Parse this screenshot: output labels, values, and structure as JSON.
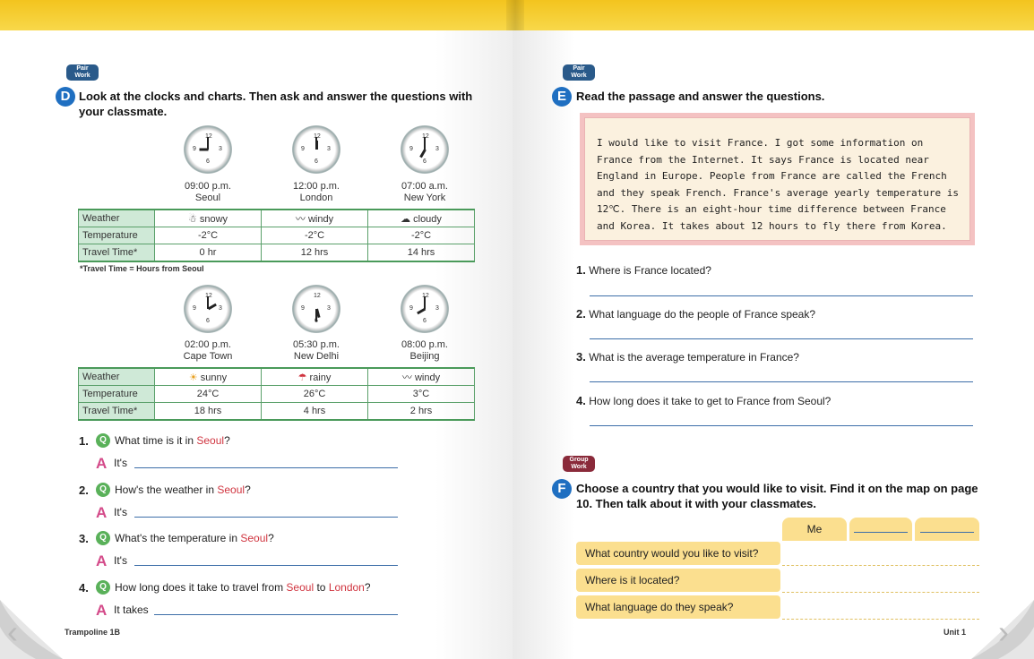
{
  "left": {
    "badge": "Pair\nWork",
    "section_letter": "D",
    "heading": "Look at the clocks and charts. Then ask and answer the questions with your classmate.",
    "clocks_top": [
      {
        "time": "09:00 p.m.",
        "city": "Seoul"
      },
      {
        "time": "12:00 p.m.",
        "city": "London"
      },
      {
        "time": "07:00 a.m.",
        "city": "New York"
      }
    ],
    "table_top": {
      "rows": [
        {
          "label": "Weather",
          "cells": [
            "snowy",
            "windy",
            "cloudy"
          ]
        },
        {
          "label": "Temperature",
          "cells": [
            "-2°C",
            "-2°C",
            "-2°C"
          ]
        },
        {
          "label": "Travel Time*",
          "cells": [
            "0 hr",
            "12 hrs",
            "14 hrs"
          ]
        }
      ]
    },
    "note": "*Travel Time = Hours from Seoul",
    "clocks_bottom": [
      {
        "time": "02:00 p.m.",
        "city": "Cape Town"
      },
      {
        "time": "05:30 p.m.",
        "city": "New Delhi"
      },
      {
        "time": "08:00 p.m.",
        "city": "Beijing"
      }
    ],
    "table_bottom": {
      "rows": [
        {
          "label": "Weather",
          "cells": [
            "sunny",
            "rainy",
            "windy"
          ]
        },
        {
          "label": "Temperature",
          "cells": [
            "24°C",
            "26°C",
            "3°C"
          ]
        },
        {
          "label": "Travel Time*",
          "cells": [
            "18 hrs",
            "4 hrs",
            "2 hrs"
          ]
        }
      ]
    },
    "questions": [
      {
        "num": "1.",
        "pre": "What time is it in ",
        "hl": "Seoul",
        "mid": "",
        "hl2": "",
        "post": "?",
        "answer": "It's"
      },
      {
        "num": "2.",
        "pre": "How's the weather in ",
        "hl": "Seoul",
        "mid": "",
        "hl2": "",
        "post": "?",
        "answer": "It's"
      },
      {
        "num": "3.",
        "pre": "What's the temperature in ",
        "hl": "Seoul",
        "mid": "",
        "hl2": "",
        "post": "?",
        "answer": "It's"
      },
      {
        "num": "4.",
        "pre": "How long does it take to travel from ",
        "hl": "Seoul",
        "mid": " to ",
        "hl2": "London",
        "post": "?",
        "answer": "It takes"
      }
    ],
    "footer": "Trampoline 1B"
  },
  "right": {
    "badge_e": "Pair\nWork",
    "section_e": "E",
    "heading_e": "Read the passage and answer the questions.",
    "passage": "I would like to visit France. I got some information on France from the Internet. It says France is located near England in Europe. People from France are called the French and they speak French. France's average yearly temperature is 12℃. There is an eight-hour time difference between France and Korea. It takes about 12 hours to fly there from Korea.",
    "questions_e": [
      {
        "num": "1.",
        "text": "Where is France located?"
      },
      {
        "num": "2.",
        "text": "What language do the people of France speak?"
      },
      {
        "num": "3.",
        "text": "What is the average temperature in France?"
      },
      {
        "num": "4.",
        "text": "How long does it take to get to France from Seoul?"
      }
    ],
    "badge_f": "Group\nWork",
    "section_f": "F",
    "heading_f": "Choose a country that you would like to visit. Find it on the map on page 10. Then talk about it with your classmates.",
    "table_f": {
      "col_me": "Me",
      "rows": [
        "What country would you like to visit?",
        "Where is it located?",
        "What language do they speak?"
      ]
    },
    "footer": "Unit 1"
  }
}
